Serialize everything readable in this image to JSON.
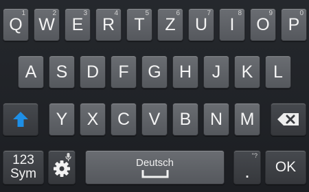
{
  "keyboard": {
    "row1": [
      {
        "letter": "Q",
        "hint": "1"
      },
      {
        "letter": "W",
        "hint": "2"
      },
      {
        "letter": "E",
        "hint": "3"
      },
      {
        "letter": "R",
        "hint": "4"
      },
      {
        "letter": "T",
        "hint": "5"
      },
      {
        "letter": "Z",
        "hint": "6"
      },
      {
        "letter": "U",
        "hint": "7"
      },
      {
        "letter": "I",
        "hint": "8"
      },
      {
        "letter": "O",
        "hint": "9"
      },
      {
        "letter": "P",
        "hint": "0"
      }
    ],
    "row2": [
      "A",
      "S",
      "D",
      "F",
      "G",
      "H",
      "J",
      "K",
      "L"
    ],
    "row3": [
      "Y",
      "X",
      "C",
      "V",
      "B",
      "N",
      "M"
    ],
    "sym_key": {
      "line1": "123",
      "line2": "Sym"
    },
    "space_label": "Deutsch",
    "period_key": {
      "label": ".",
      "hint": "\"?"
    },
    "ok_label": "OK",
    "accent_color": "#1e8fe6",
    "icons": {
      "shift": "shift-up-arrow-icon",
      "backspace": "backspace-icon",
      "settings": "settings-gear-icon",
      "mic": "microphone-icon"
    }
  }
}
